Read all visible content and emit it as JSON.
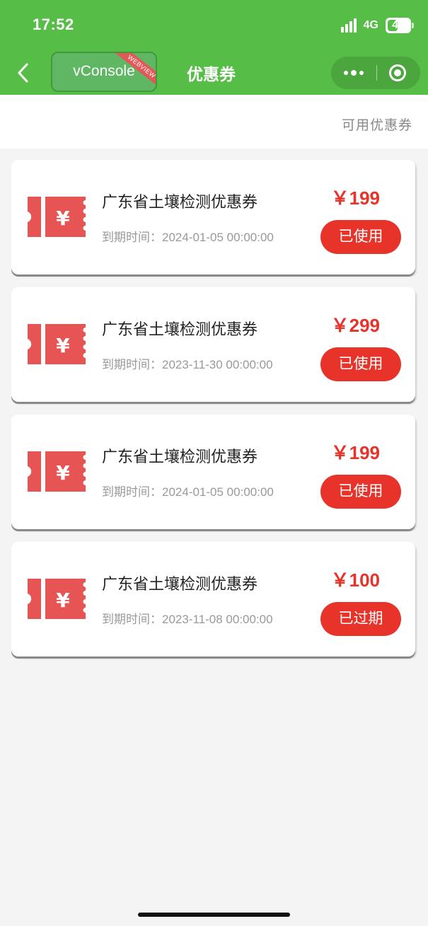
{
  "status_bar": {
    "time": "17:52",
    "network": "4G",
    "battery": "45",
    "battery_level": 0.45
  },
  "nav": {
    "vconsole_label": "vConsole",
    "webview_tag": "WEBVIEW",
    "title": "优惠券"
  },
  "subheader": {
    "link": "可用优惠券"
  },
  "coupons": [
    {
      "name": "广东省土壤检测优惠券",
      "expiry": "到期时间：2024-01-05 00:00:00",
      "price": "￥199",
      "status": "已使用"
    },
    {
      "name": "广东省土壤检测优惠券",
      "expiry": "到期时间：2023-11-30 00:00:00",
      "price": "￥299",
      "status": "已使用"
    },
    {
      "name": "广东省土壤检测优惠券",
      "expiry": "到期时间：2024-01-05 00:00:00",
      "price": "￥199",
      "status": "已使用"
    },
    {
      "name": "广东省土壤检测优惠券",
      "expiry": "到期时间：2023-11-08 00:00:00",
      "price": "￥100",
      "status": "已过期"
    }
  ],
  "colors": {
    "brand_green": "#56bd46",
    "accent_red": "#e8332a",
    "ticket_icon": "#e65454"
  }
}
